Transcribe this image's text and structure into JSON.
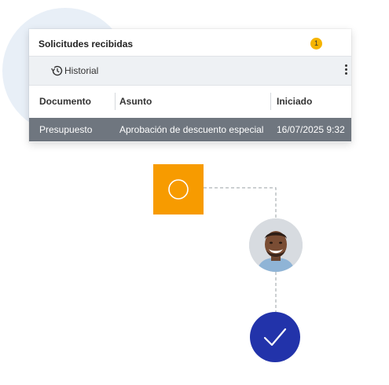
{
  "panel": {
    "title": "Solicitudes recibidas",
    "badge_count": "1",
    "toolbar": {
      "history_icon": "history-icon",
      "history_label": "Historial",
      "more_icon": "kebab-menu-icon"
    },
    "columns": [
      "Documento",
      "Asunto",
      "Iniciado"
    ],
    "rows": [
      {
        "documento": "Presupuesto",
        "asunto": "Aprobación de descuento especial",
        "iniciado": "16/07/2025 9:32"
      }
    ]
  },
  "workflow": {
    "step_pending_icon": "circle-icon",
    "approver_icon": "user-avatar",
    "step_done_icon": "checkmark-icon",
    "colors": {
      "accent_orange": "#f79b00",
      "approved_blue": "#2233aa",
      "badge_yellow": "#f5b400",
      "selected_row": "#6f767f"
    }
  }
}
